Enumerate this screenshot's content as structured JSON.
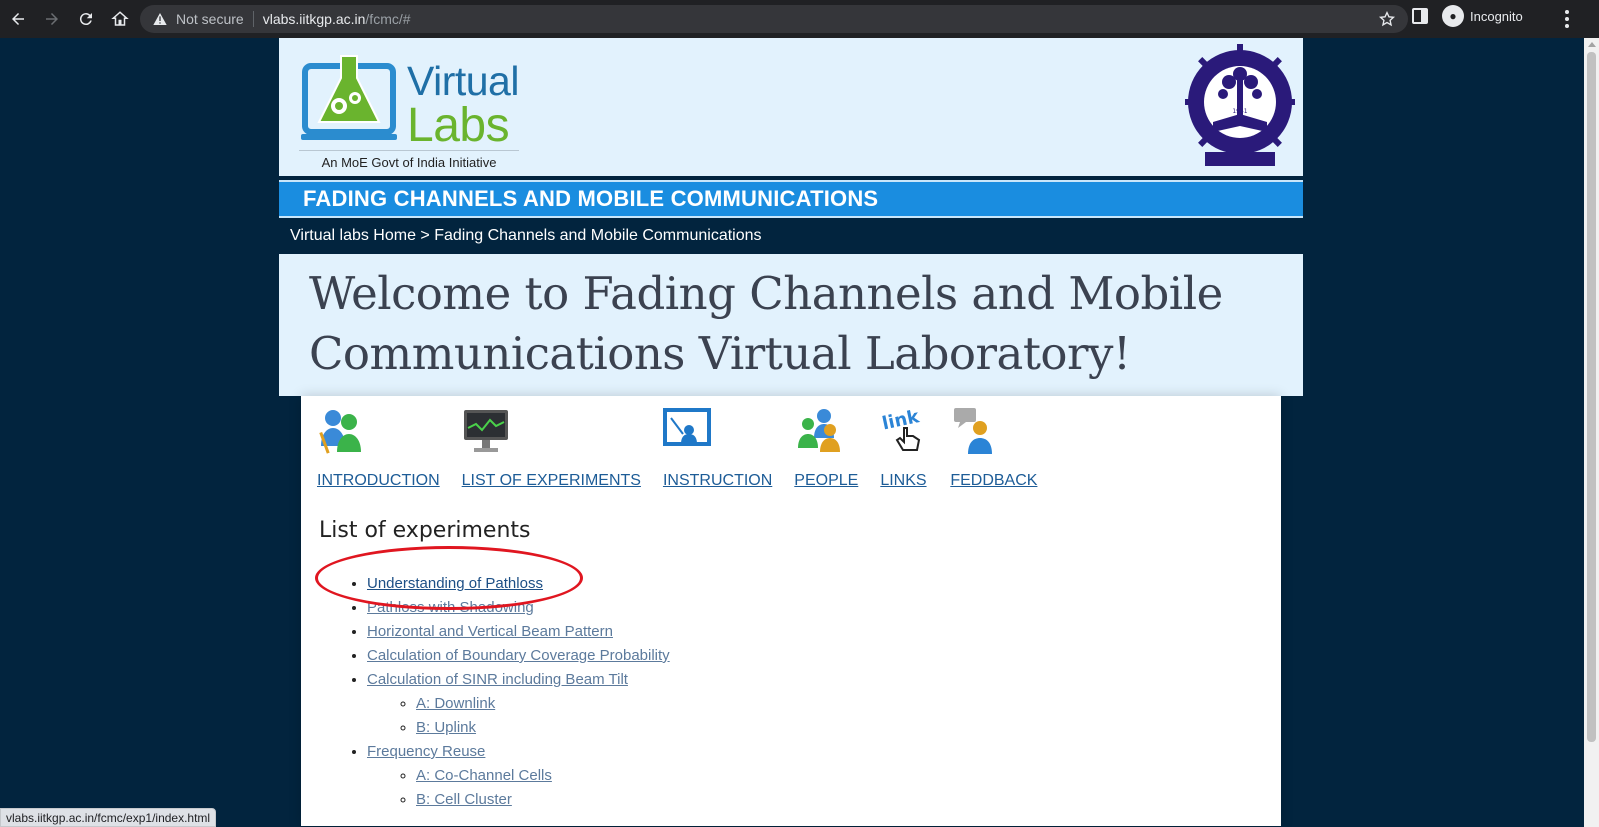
{
  "browser": {
    "security_label": "Not secure",
    "url_host": "vlabs.iitkgp.ac.in",
    "url_path": "/fcmc/#",
    "profile_label": "Incognito"
  },
  "header": {
    "logo_word1": "Virtual",
    "logo_word2": "Labs",
    "tagline": "An MoE Govt of India Initiative",
    "institute_seal_text": "INDIAN INSTITUTE OF TECHNOLOGY KHARAGPUR",
    "seal_year": "1951"
  },
  "lab_title": "FADING CHANNELS AND MOBILE COMMUNICATIONS",
  "breadcrumb": "Virtual labs Home > Fading Channels and Mobile Communications",
  "welcome": "Welcome to Fading Channels and Mobile Communications Virtual Laboratory!",
  "nav": [
    {
      "label": "INTRODUCTION",
      "icon": "people-icon"
    },
    {
      "label": "LIST OF EXPERIMENTS",
      "icon": "monitor-icon"
    },
    {
      "label": "INSTRUCTION",
      "icon": "presentation-icon"
    },
    {
      "label": "PEOPLE",
      "icon": "group-icon"
    },
    {
      "label": "LINKS",
      "icon": "link-cursor-icon"
    },
    {
      "label": "FEDDBACK",
      "icon": "feedback-person-icon"
    }
  ],
  "experiments": {
    "title": "List of experiments",
    "items": [
      {
        "label": "Understanding of Pathloss"
      },
      {
        "label": "Pathloss with Shadowing"
      },
      {
        "label": "Horizontal and Vertical Beam Pattern"
      },
      {
        "label": "Calculation of Boundary Coverage Probability"
      },
      {
        "label": "Calculation of SINR including Beam Tilt",
        "sub": [
          "A: Downlink",
          "B: Uplink"
        ]
      },
      {
        "label": "Frequency Reuse",
        "sub": [
          "A: Co-Channel Cells",
          "B: Cell Cluster"
        ]
      }
    ]
  },
  "status_url": "vlabs.iitkgp.ac.in/fcmc/exp1/index.html",
  "colors": {
    "page_bg": "#02243e",
    "title_bar": "#1a8de0",
    "header_bg": "#e2f2fd",
    "highlight": "#e01620"
  }
}
